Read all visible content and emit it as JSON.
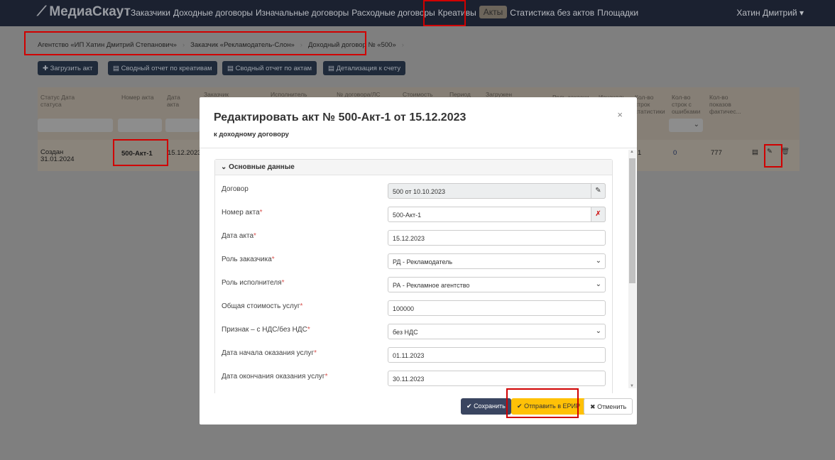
{
  "nav": {
    "brand": "МедиаСкаут",
    "items": [
      "Заказчики",
      "Доходные договоры",
      "Изначальные договоры",
      "Расходные договоры",
      "Креативы",
      "Акты",
      "Статистика без актов",
      "Площадки"
    ],
    "active": "Акты",
    "user": "Хатин Дмитрий"
  },
  "breadcrumb": [
    "Агентство «ИП Хатин Дмитрий Степанович»",
    "Заказчик «Рекламодатель-Слон»",
    "Доходный договор № «500»"
  ],
  "toolbar": {
    "upload": "Загрузить акт",
    "creatives_report": "Сводный отчет по креативам",
    "acts_report": "Сводный отчет по актам",
    "invoice_detail": "Детализация к счету"
  },
  "table": {
    "headers": [
      "Статус Дата статуса",
      "Номер акта",
      "Дата акта",
      "Заказчик",
      "Исполнитель",
      "№ договора/ЛС",
      "Стоимость",
      "Период",
      "Загружен",
      "Роль заказчи",
      "Изначаль",
      "Кол-во строк статистики",
      "Кол-во строк с ошибками",
      "Кол-во показов фактичес..."
    ],
    "row": {
      "status": "Создан",
      "status_date": "31.01.2024",
      "number": "500-Акт-1",
      "date": "15.12.2023",
      "stat_rows": "1",
      "error_rows": "0",
      "impressions": "777"
    }
  },
  "modal": {
    "title": "Редактировать акт № 500-Акт-1 от 15.12.2023",
    "subtitle": "к доходному договору",
    "section": "Основные данные",
    "fields": [
      {
        "label": "Договор",
        "value": "500 от 10.10.2023",
        "required": false
      },
      {
        "label": "Номер акта",
        "value": "500-Акт-1",
        "required": true
      },
      {
        "label": "Дата акта",
        "value": "15.12.2023",
        "required": true
      },
      {
        "label": "Роль заказчика",
        "value": "РД - Рекламодатель",
        "required": true
      },
      {
        "label": "Роль исполнителя",
        "value": "РА - Рекламное агентство",
        "required": true
      },
      {
        "label": "Общая стоимость услуг",
        "value": "100000",
        "required": true
      },
      {
        "label": "Признак – с НДС/без НДС",
        "value": "без НДС",
        "required": true
      },
      {
        "label": "Дата начала оказания услуг",
        "value": "01.11.2023",
        "required": true
      },
      {
        "label": "Дата окончания оказания услуг",
        "value": "30.11.2023",
        "required": true
      }
    ],
    "save": "Сохранить",
    "send": "Отправить в ЕРИР",
    "cancel": "Отменить",
    "req_mark": "*"
  },
  "colors": {
    "nav": "#1b2130",
    "primary": "#3a4560",
    "warning": "#ffc107",
    "highlight": "#d00000"
  }
}
